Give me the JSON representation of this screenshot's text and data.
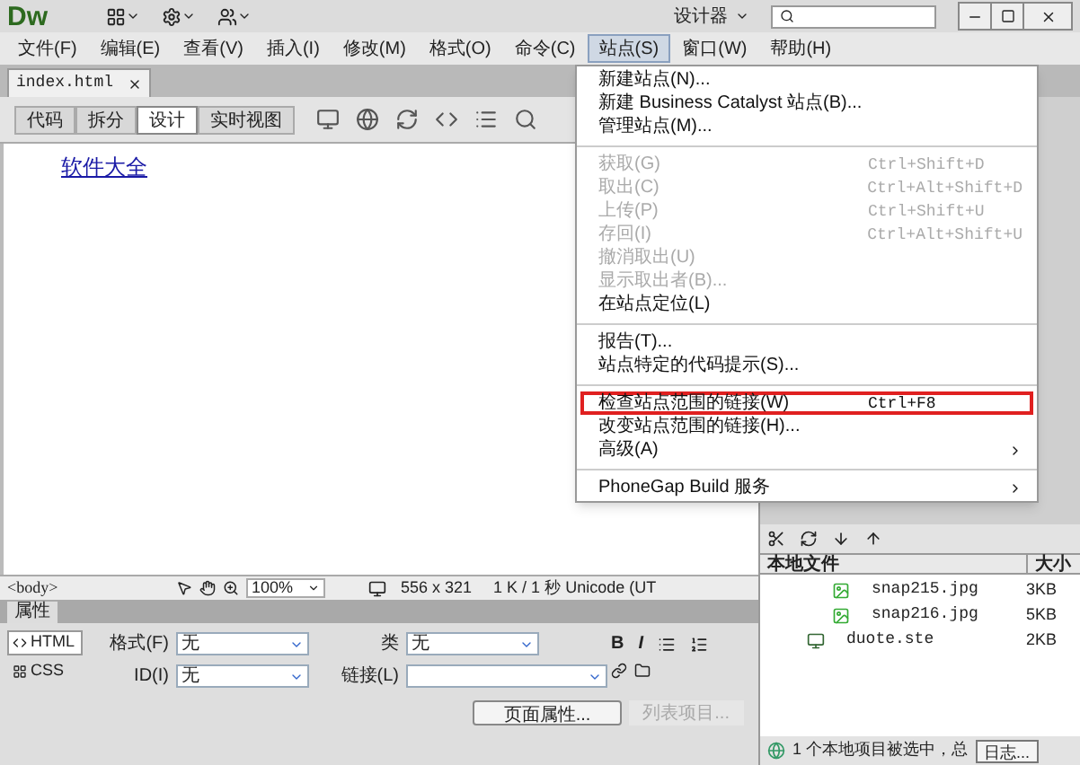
{
  "title_bar": {
    "logo": "Dw",
    "workspace": "设计器"
  },
  "menu_bar": [
    {
      "label": "文件(F)",
      "selected": false
    },
    {
      "label": "编辑(E)",
      "selected": false
    },
    {
      "label": "查看(V)",
      "selected": false
    },
    {
      "label": "插入(I)",
      "selected": false
    },
    {
      "label": "修改(M)",
      "selected": false
    },
    {
      "label": "格式(O)",
      "selected": false
    },
    {
      "label": "命令(C)",
      "selected": false
    },
    {
      "label": "站点(S)",
      "selected": true
    },
    {
      "label": "窗口(W)",
      "selected": false
    },
    {
      "label": "帮助(H)",
      "selected": false
    }
  ],
  "doc_tabs": [
    {
      "label": "index.html",
      "selected": true
    }
  ],
  "view_buttons": [
    {
      "label": "代码",
      "selected": false
    },
    {
      "label": "拆分",
      "selected": false
    },
    {
      "label": "设计",
      "selected": true
    },
    {
      "label": "实时视图",
      "selected": false
    }
  ],
  "page": {
    "link": "软件大全"
  },
  "status_bar": {
    "tag": "<body>",
    "zoom": "100%",
    "size": "556 x 321",
    "info": "1 K / 1 秒 Unicode (UT"
  },
  "properties": {
    "title": "属性",
    "modes": [
      {
        "label": "HTML",
        "selected": true
      },
      {
        "label": "CSS",
        "selected": false
      }
    ],
    "fields": [
      {
        "label": "格式(F)",
        "value": "无"
      },
      {
        "label": "ID(I)",
        "value": "无"
      },
      {
        "label": "类",
        "value": "无"
      }
    ],
    "link_label": "链接(L)",
    "bold": "B",
    "italic": "I",
    "buttons": [
      {
        "label": "页面属性...",
        "disabled": false
      },
      {
        "label": "列表项目...",
        "disabled": true
      }
    ]
  },
  "files_panel": {
    "columns": [
      "本地文件",
      "大小"
    ],
    "rows": [
      {
        "name": "snap215.jpg",
        "size": "3KB",
        "kind": "image"
      },
      {
        "name": "snap216.jpg",
        "size": "5KB",
        "kind": "image"
      },
      {
        "name": "duote.ste",
        "size": "2KB",
        "kind": "site"
      }
    ],
    "status": "1 个本地项目被选中，总",
    "log_button": "日志..."
  },
  "site_menu": [
    {
      "kind": "item",
      "label": "新建站点(N)...",
      "disabled": false,
      "submenu": false,
      "highlighted": false
    },
    {
      "kind": "item",
      "label": "新建 Business Catalyst 站点(B)...",
      "disabled": false,
      "submenu": false,
      "highlighted": false
    },
    {
      "kind": "item",
      "label": "管理站点(M)...",
      "disabled": false,
      "submenu": false,
      "highlighted": false
    },
    {
      "kind": "separator"
    },
    {
      "kind": "item",
      "label": "获取(G)",
      "shortcut": "Ctrl+Shift+D",
      "disabled": true,
      "submenu": false,
      "highlighted": false
    },
    {
      "kind": "item",
      "label": "取出(C)",
      "shortcut": "Ctrl+Alt+Shift+D",
      "disabled": true,
      "submenu": false,
      "highlighted": false
    },
    {
      "kind": "item",
      "label": "上传(P)",
      "shortcut": "Ctrl+Shift+U",
      "disabled": true,
      "submenu": false,
      "highlighted": false
    },
    {
      "kind": "item",
      "label": "存回(I)",
      "shortcut": "Ctrl+Alt+Shift+U",
      "disabled": true,
      "submenu": false,
      "highlighted": false
    },
    {
      "kind": "item",
      "label": "撤消取出(U)",
      "disabled": true,
      "submenu": false,
      "highlighted": false
    },
    {
      "kind": "item",
      "label": "显示取出者(B)...",
      "disabled": true,
      "submenu": false,
      "highlighted": false
    },
    {
      "kind": "item",
      "label": "在站点定位(L)",
      "disabled": false,
      "submenu": false,
      "highlighted": false
    },
    {
      "kind": "separator"
    },
    {
      "kind": "item",
      "label": "报告(T)...",
      "disabled": false,
      "submenu": false,
      "highlighted": false
    },
    {
      "kind": "item",
      "label": "站点特定的代码提示(S)...",
      "disabled": false,
      "submenu": false,
      "highlighted": false
    },
    {
      "kind": "separator"
    },
    {
      "kind": "item",
      "label": "检查站点范围的链接(W)",
      "shortcut": "Ctrl+F8",
      "disabled": false,
      "submenu": false,
      "highlighted": true
    },
    {
      "kind": "item",
      "label": "改变站点范围的链接(H)...",
      "disabled": false,
      "submenu": false,
      "highlighted": false
    },
    {
      "kind": "item",
      "label": "高级(A)",
      "disabled": false,
      "submenu": true,
      "highlighted": false
    },
    {
      "kind": "separator"
    },
    {
      "kind": "item",
      "label": "PhoneGap Build 服务",
      "disabled": false,
      "submenu": true,
      "highlighted": false
    }
  ]
}
